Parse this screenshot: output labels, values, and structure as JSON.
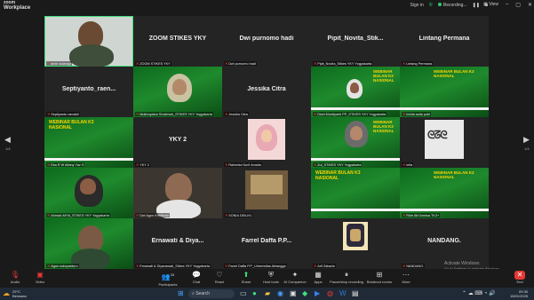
{
  "app": {
    "brand_line1": "zoom",
    "brand_line2": "Workplace"
  },
  "topbar": {
    "signin": "Sign in",
    "recording": "Recording...",
    "view": "View"
  },
  "nav": {
    "left_page": "1/4",
    "right_page": "1/4"
  },
  "tiles": [
    {
      "label": "amin sutarigo",
      "big": ""
    },
    {
      "label": "ZOOM STIKES YKY",
      "big": "ZOOM STIKES YKY"
    },
    {
      "label": "Dwi purnomo hadi",
      "big": "Dwi purnomo hadi"
    },
    {
      "label": "Pipit_Novita_Stikes YKY Yogyakarta",
      "big": "Pipit_Novita_Stik..."
    },
    {
      "label": "Lintang Permana",
      "big": "Lintang Permana"
    },
    {
      "label": "Septiyanto ramaldi",
      "big": "Septiyanto_raen..."
    },
    {
      "label": "Mukhoyatun Sholehah_STIKES YKY Yogyakarta",
      "big": ""
    },
    {
      "label": "Jessika Citra",
      "big": "Jessika Citra"
    },
    {
      "label": "Dewi Murdiyanti PP_STIKES YKY Yogyakarta",
      "big": ""
    },
    {
      "label": "Inrida aulia putri",
      "big": ""
    },
    {
      "label": "Eka R W Alfany Yaz S",
      "big": ""
    },
    {
      "label": "YKY 2",
      "big": "YKY 2"
    },
    {
      "label": "Rahmida Nuril Amalia",
      "big": ""
    },
    {
      "label": "Zul_STIKES YKY Yogyakarta",
      "big": ""
    },
    {
      "label": "infia",
      "big": ""
    },
    {
      "label": "Ahmad Aff M_STIKES YKY Yogyakarta",
      "big": ""
    },
    {
      "label": "Dwi Agus Kristianto",
      "big": ""
    },
    {
      "label": "SONIA DEILIKI",
      "big": ""
    },
    {
      "label": "",
      "big": ""
    },
    {
      "label": "Ririe Afri Annisa TK3+",
      "big": ""
    },
    {
      "label": "Agus sukoyanturo",
      "big": ""
    },
    {
      "label": "Ernawati & Diyanawati_Stikes YKY Yogyakarta",
      "big": "Ernawati & Diya..."
    },
    {
      "label": "Farrel Daffa P.P_Universitas Airlangga",
      "big": "Farrel Daffa P.P..."
    },
    {
      "label": "Arif Zakaria",
      "big": ""
    },
    {
      "label": "NANDANG.",
      "big": "NANDANG."
    }
  ],
  "webinar": {
    "line1": "WEBINAR BULAN K3",
    "line2": "NASIONAL"
  },
  "bottom": {
    "audio": "Audio",
    "video": "Video",
    "participants": "Participants",
    "participants_count": "33",
    "chat": "Chat",
    "react": "React",
    "share": "Share",
    "host": "Host tools",
    "ai": "AI Companion",
    "apps": "Apps",
    "pause": "Pause/stop recording",
    "breakout": "Breakout rooms",
    "more": "More",
    "end": "End"
  },
  "activate": {
    "line1": "Activate Windows",
    "line2": "Go to Settings to activate Windows."
  },
  "taskbar": {
    "temp": "29°C",
    "weather": "Berawan",
    "search": "Search",
    "time": "09:30",
    "date": "15/01/2025"
  },
  "colors": {
    "accent_green": "#3ee07a",
    "end_red": "#e53935"
  }
}
